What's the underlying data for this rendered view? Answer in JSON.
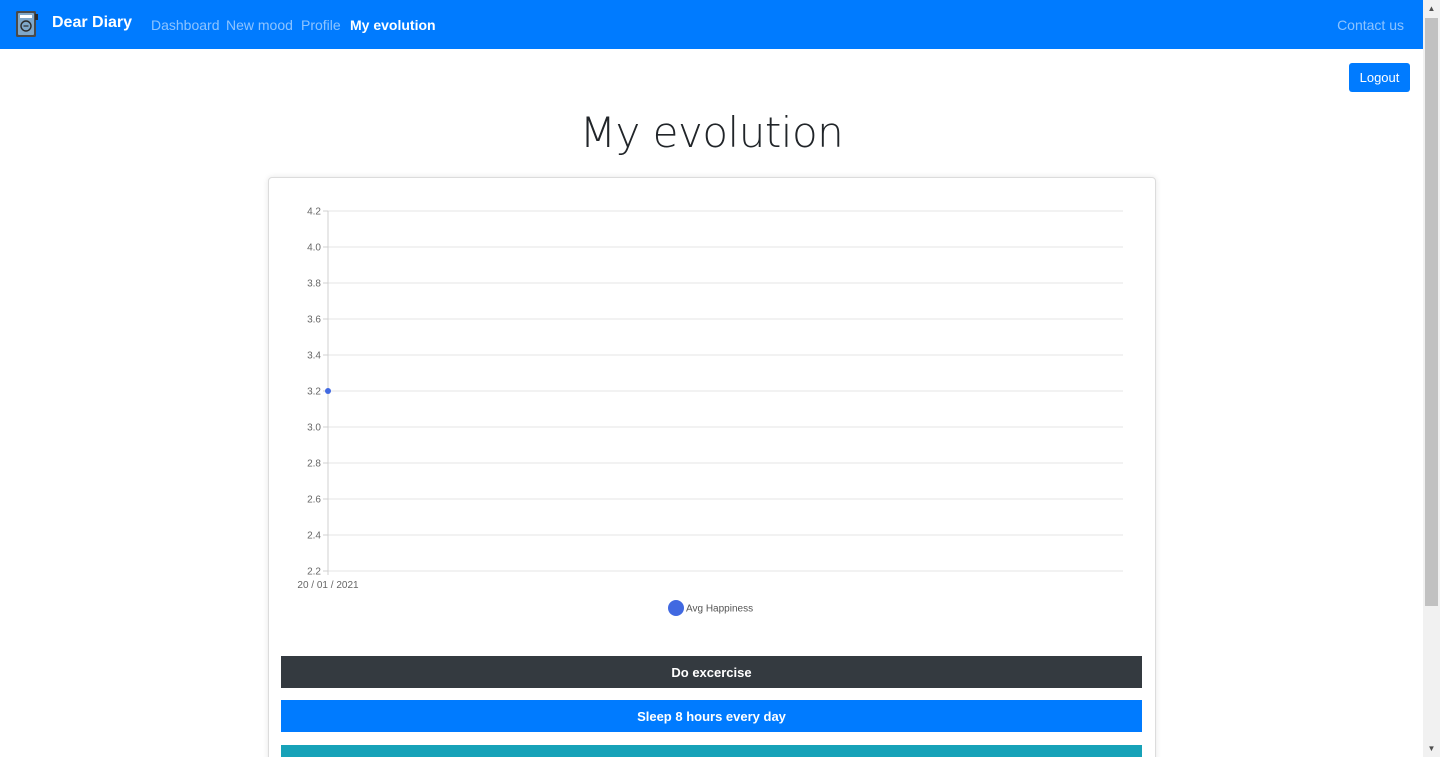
{
  "nav": {
    "brand": "Dear Diary",
    "logo_icon": "diary-book-icon",
    "links": [
      "Dashboard",
      "New mood",
      "Profile",
      "My evolution"
    ],
    "active": "My evolution",
    "contact": "Contact us"
  },
  "logout_label": "Logout",
  "title": "My evolution",
  "chart_data": {
    "type": "line",
    "x": [
      "20 / 01 / 2021"
    ],
    "series": [
      {
        "name": "Avg Happiness",
        "values": [
          3.2
        ],
        "color": "#4169e1"
      }
    ],
    "yticks": [
      "4.2",
      "4.0",
      "3.8",
      "3.6",
      "3.4",
      "3.2",
      "3.0",
      "2.8",
      "2.6",
      "2.4",
      "2.2"
    ],
    "ylim": [
      2.2,
      4.2
    ],
    "grid": true,
    "legend_position": "bottom"
  },
  "goals": [
    {
      "label": "Do excercise",
      "color": "#343a40"
    },
    {
      "label": "Sleep 8 hours every day",
      "color": "#007bff"
    },
    {
      "label": "",
      "color": "#17a2b8"
    }
  ],
  "colors": {
    "primary": "#007bff",
    "dark": "#343a40",
    "info": "#17a2b8"
  }
}
